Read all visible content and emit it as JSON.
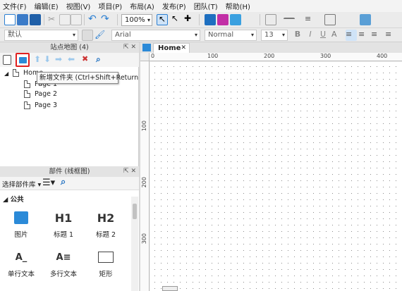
{
  "menu": [
    "文件(F)",
    "编辑(E)",
    "视图(V)",
    "项目(P)",
    "布局(A)",
    "发布(P)",
    "团队(T)",
    "帮助(H)"
  ],
  "toolbar": {
    "zoom": "100%"
  },
  "format": {
    "style": "默认",
    "font": "Arial",
    "weight": "Normal",
    "size": "13"
  },
  "sitemap": {
    "title": "站点地图 (4)",
    "home": "Home",
    "pages": [
      "Page 2",
      "Page 3"
    ],
    "partial_page": "Page 1",
    "tooltip": "新增文件夹 (Ctrl+Shift+Return)"
  },
  "widgets": {
    "title": "部件 (线框图)",
    "library": "选择部件库",
    "section": "公共",
    "items": [
      {
        "glyph": "",
        "label": "图片"
      },
      {
        "glyph": "H1",
        "label": "标题 1"
      },
      {
        "glyph": "H2",
        "label": "标题 2"
      },
      {
        "glyph": "A_",
        "label": "单行文本"
      },
      {
        "glyph": "A≡",
        "label": "多行文本"
      },
      {
        "glyph": "",
        "label": "矩形"
      }
    ]
  },
  "canvas": {
    "tab": "Home",
    "ruler_top": [
      "0",
      "100",
      "200",
      "300",
      "400"
    ],
    "ruler_left": [
      "100",
      "200",
      "300"
    ]
  },
  "colors": {
    "accent": "#2b7fd2",
    "highlight": "#e02020"
  }
}
